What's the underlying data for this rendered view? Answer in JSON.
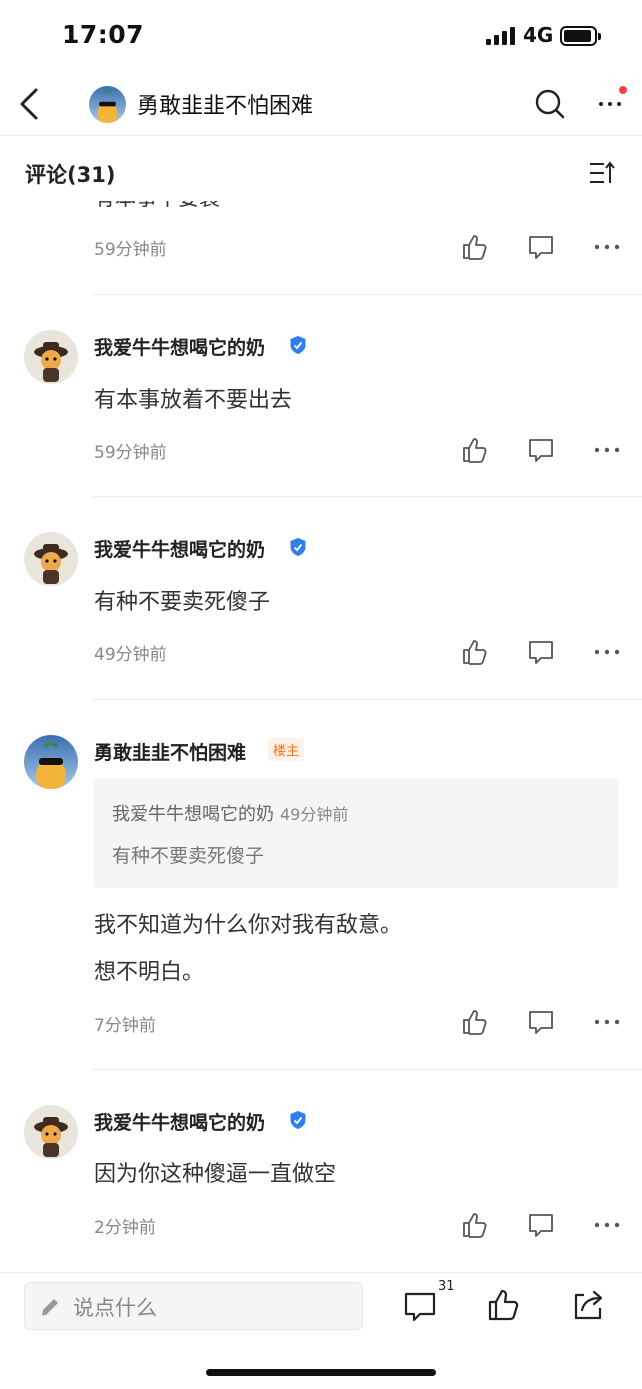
{
  "status_bar": {
    "time": "17:07",
    "network": "4G"
  },
  "nav": {
    "title": "勇敢韭韭不怕困难"
  },
  "comments_header": {
    "title": "评论(31)"
  },
  "clipped_comment": {
    "content": "有本事不要装",
    "time": "59分钟前"
  },
  "comments": [
    {
      "username": "我爱牛牛想喝它的奶",
      "content": "有本事放着不要出去",
      "time": "59分钟前"
    },
    {
      "username": "我爱牛牛想喝它的奶",
      "content": "有种不要卖死傻子",
      "time": "49分钟前"
    },
    {
      "username": "勇敢韭韭不怕困难",
      "badge": "楼主",
      "quote": {
        "username": "我爱牛牛想喝它的奶",
        "time": "49分钟前",
        "content": "有种不要卖死傻子"
      },
      "content_line1": "我不知道为什么你对我有敌意。",
      "content_line2": "想不明白。",
      "time": "7分钟前"
    },
    {
      "username": "我爱牛牛想喝它的奶",
      "content": "因为你这种傻逼一直做空",
      "time": "2分钟前"
    }
  ],
  "bottom_bar": {
    "input_placeholder": "说点什么",
    "comment_count": "31"
  },
  "colors": {
    "verified": "#2f7ff0",
    "op_badge": "#f97316",
    "notification_dot": "#ef4444"
  },
  "icons": [
    "back-icon",
    "search-icon",
    "more-icon",
    "sort-icon",
    "like-icon",
    "comment-icon",
    "share-icon",
    "pencil-icon",
    "verified-icon"
  ]
}
